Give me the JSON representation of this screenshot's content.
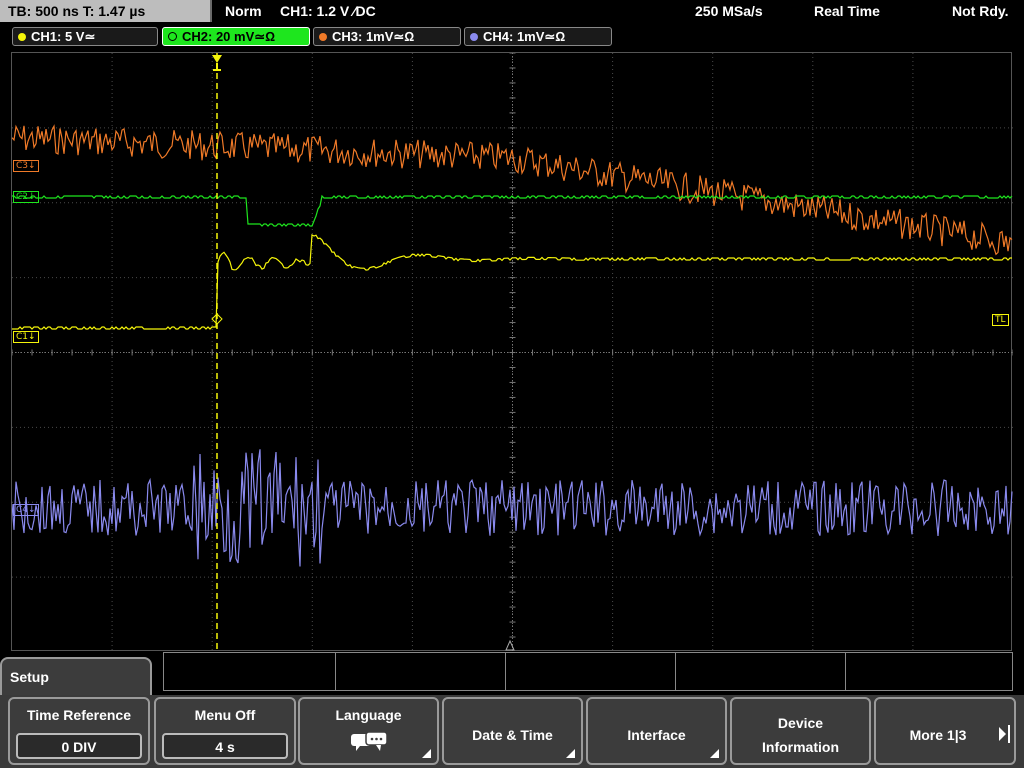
{
  "topbar": {
    "timebase": "TB: 500 ns   T: 1.47 µs",
    "mode": "Norm",
    "trigger": "CH1: 1.2 V ∕DC",
    "sample_rate": "250 MSa/s",
    "acq_mode": "Real Time",
    "status": "Not Rdy."
  },
  "channels": [
    {
      "label": "CH1: 5 V≃",
      "color": "#f5f50a",
      "active": false
    },
    {
      "label": "CH2: 20 mV≃Ω",
      "color": "#1ee61e",
      "active": true
    },
    {
      "label": "CH3: 1mV≃Ω",
      "color": "#f07a28",
      "active": false
    },
    {
      "label": "CH4: 1mV≃Ω",
      "color": "#8a8aee",
      "active": false
    }
  ],
  "markers": {
    "c3": "C3↓",
    "c2": "C2↓",
    "c1": "C1↓",
    "c4": "C4↓",
    "tl": "TL"
  },
  "menu": {
    "title": "Setup",
    "time_reference": {
      "label": "Time Reference",
      "value": "0 DIV"
    },
    "menu_off": {
      "label": "Menu Off",
      "value": "4 s"
    },
    "language": {
      "label": "Language"
    },
    "date_time": {
      "label": "Date & Time"
    },
    "interface": {
      "label": "Interface"
    },
    "device_information": {
      "line1": "Device",
      "line2": "Information"
    },
    "more": {
      "label": "More 1|3"
    }
  },
  "colors": {
    "ch1": "#f5f50a",
    "ch2": "#1ee61e",
    "ch3": "#f07a28",
    "ch4": "#8a8aee",
    "grid": "#4a4a4a"
  }
}
